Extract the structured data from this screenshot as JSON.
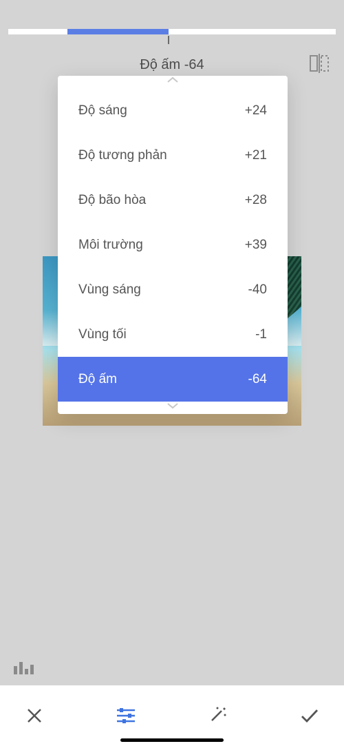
{
  "slider": {
    "fill_left_pct": 18,
    "fill_width_pct": 31,
    "center_pct": 49
  },
  "header": {
    "label": "Độ ấm -64"
  },
  "panel": {
    "rows": [
      {
        "label": "Độ sáng",
        "value": "+24",
        "selected": false,
        "overlay": false
      },
      {
        "label": "Độ tương phản",
        "value": "+21",
        "selected": false,
        "overlay": false
      },
      {
        "label": "Độ bão hòa",
        "value": "+28",
        "selected": false,
        "overlay": false
      },
      {
        "label": "Môi trường",
        "value": "+39",
        "selected": false,
        "overlay": false
      },
      {
        "label": "Vùng sáng",
        "value": "-40",
        "selected": false,
        "overlay": true
      },
      {
        "label": "Vùng tối",
        "value": "-1",
        "selected": false,
        "overlay": true
      },
      {
        "label": "Độ ấm",
        "value": "-64",
        "selected": true,
        "overlay": false
      }
    ]
  },
  "colors": {
    "accent": "#5473e8",
    "slider_fill": "#5b7ee5"
  },
  "icons": {
    "compare": "compare-icon",
    "histogram": "histogram-icon",
    "close": "close-icon",
    "tune": "tune-icon",
    "magic": "magic-wand-icon",
    "check": "check-icon"
  }
}
